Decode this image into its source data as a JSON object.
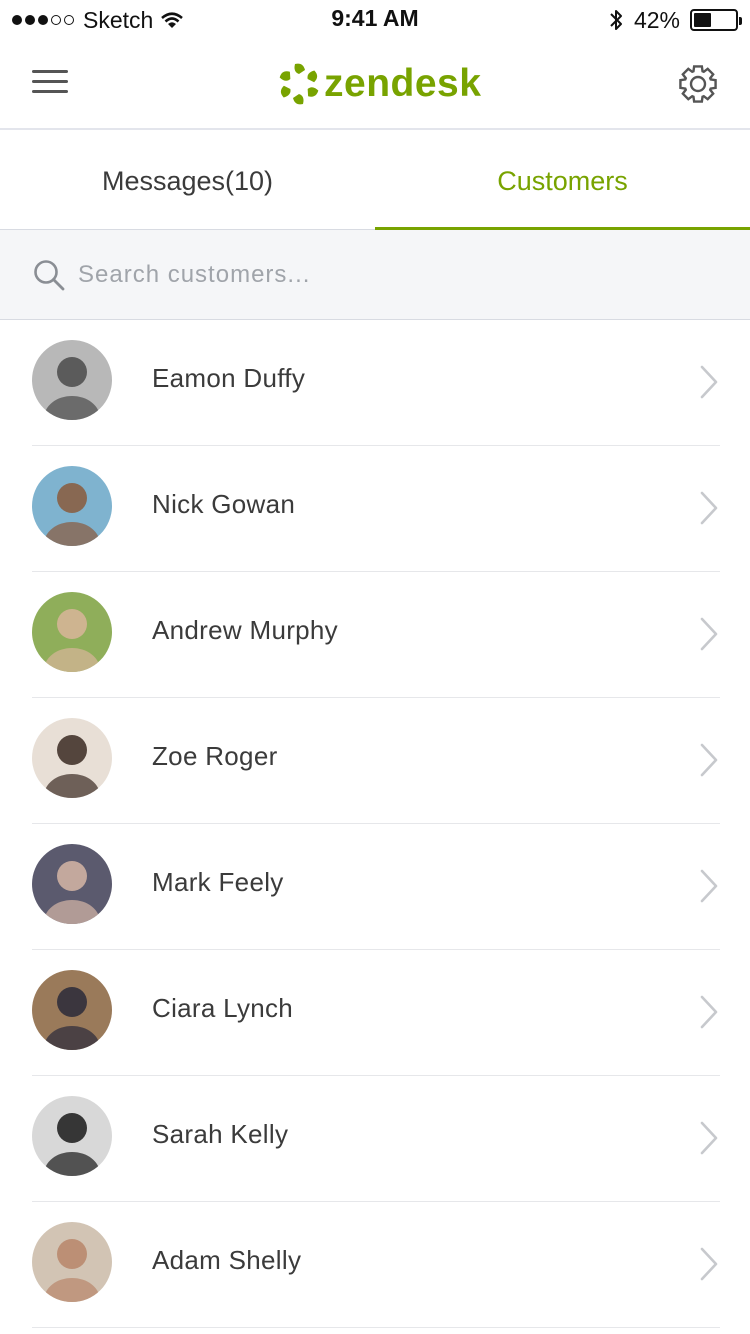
{
  "status_bar": {
    "carrier": "Sketch",
    "time": "9:41 AM",
    "battery_percent": "42%",
    "battery_level": 0.42,
    "signal_bars_filled": 3,
    "signal_bars_total": 5
  },
  "header": {
    "logo_text": "zendesk",
    "menu_icon": "hamburger-menu-icon",
    "settings_icon": "gear-icon",
    "brand_color": "#78a300"
  },
  "tabs": [
    {
      "label": "Messages(10)",
      "active": false
    },
    {
      "label": "Customers",
      "active": true
    }
  ],
  "search": {
    "placeholder": "Search customers...",
    "value": ""
  },
  "customers": [
    {
      "name": "Eamon Duffy",
      "avatar_colors": [
        "#b8b8b8",
        "#4a4a4a"
      ]
    },
    {
      "name": "Nick Gowan",
      "avatar_colors": [
        "#7fb3cf",
        "#8a5a3c"
      ]
    },
    {
      "name": "Andrew Murphy",
      "avatar_colors": [
        "#8fae5a",
        "#d9b59a"
      ]
    },
    {
      "name": "Zoe Roger",
      "avatar_colors": [
        "#e8dfd6",
        "#3a2a22"
      ]
    },
    {
      "name": "Mark Feely",
      "avatar_colors": [
        "#5b5a6e",
        "#d6b6a6"
      ]
    },
    {
      "name": "Ciara Lynch",
      "avatar_colors": [
        "#9a7a5a",
        "#2a2a3a"
      ]
    },
    {
      "name": "Sarah Kelly",
      "avatar_colors": [
        "#d8d8d8",
        "#1a1a1a"
      ]
    },
    {
      "name": "Adam Shelly",
      "avatar_colors": [
        "#d2c4b4",
        "#b8866a"
      ]
    }
  ]
}
